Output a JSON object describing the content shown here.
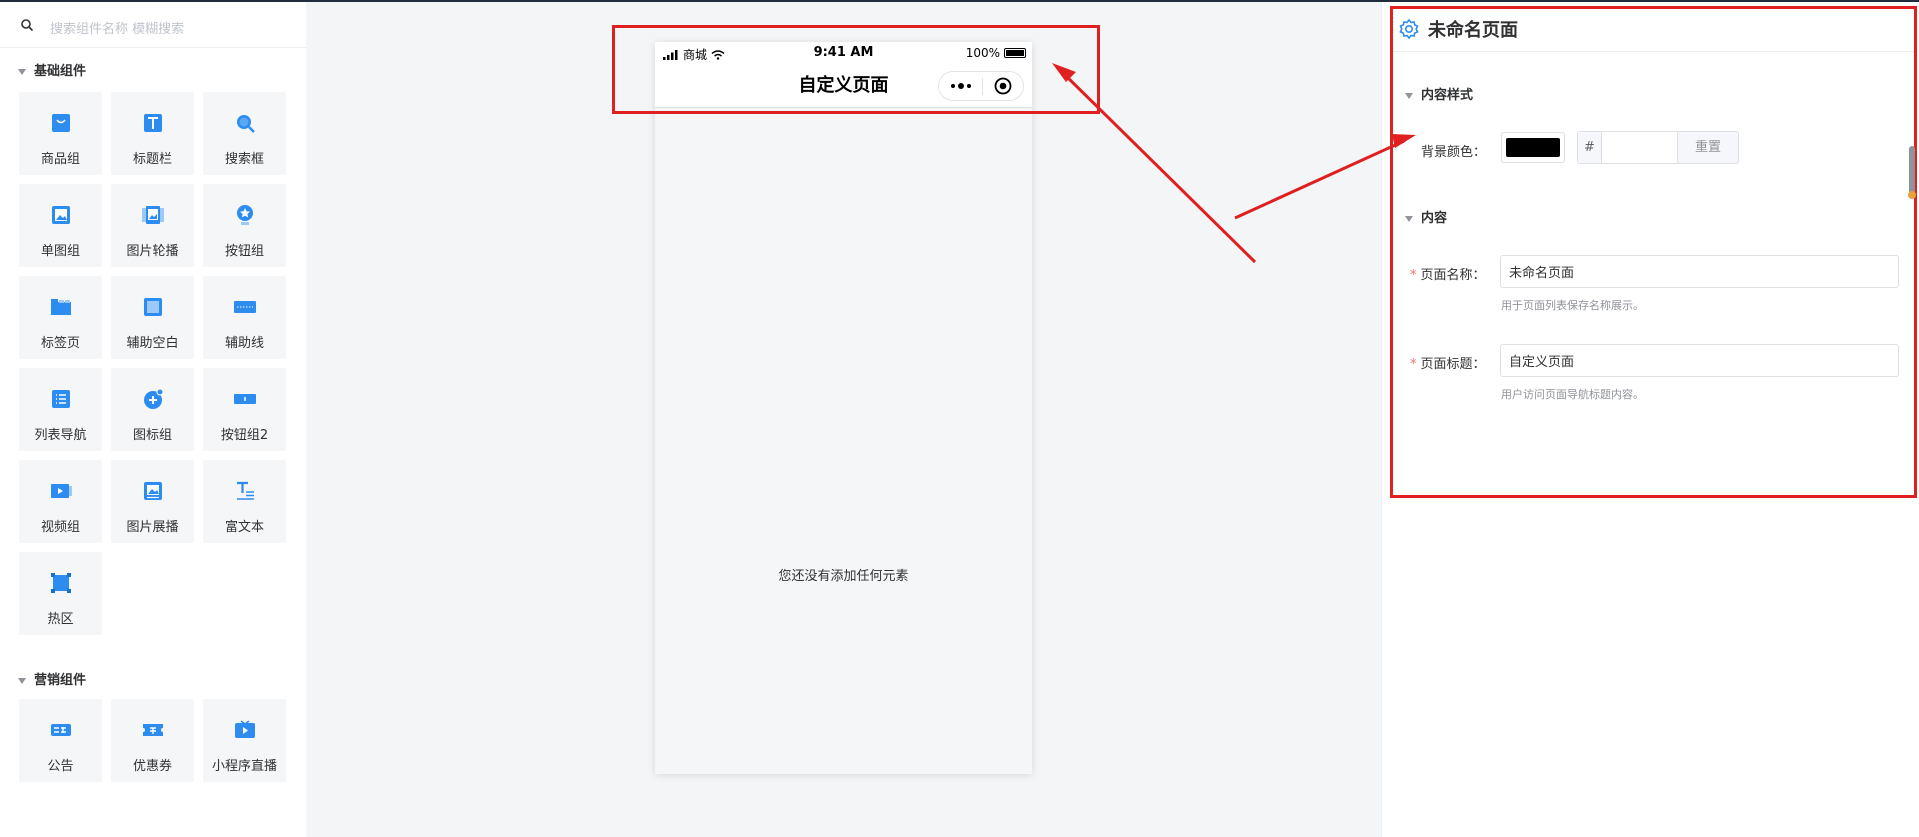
{
  "search": {
    "placeholder": "搜索组件名称 模糊搜索",
    "icon": "search-icon"
  },
  "categories": [
    {
      "title": "基础组件",
      "items": [
        {
          "label": "商品组",
          "icon": "product-group-icon"
        },
        {
          "label": "标题栏",
          "icon": "title-bar-icon"
        },
        {
          "label": "搜索框",
          "icon": "search-box-icon"
        },
        {
          "label": "单图组",
          "icon": "single-image-icon"
        },
        {
          "label": "图片轮播",
          "icon": "image-carousel-icon"
        },
        {
          "label": "按钮组",
          "icon": "button-group-icon"
        },
        {
          "label": "标签页",
          "icon": "tabs-icon"
        },
        {
          "label": "辅助空白",
          "icon": "blank-space-icon"
        },
        {
          "label": "辅助线",
          "icon": "divider-line-icon"
        },
        {
          "label": "列表导航",
          "icon": "list-nav-icon"
        },
        {
          "label": "图标组",
          "icon": "icon-group-icon"
        },
        {
          "label": "按钮组2",
          "icon": "button-group2-icon"
        },
        {
          "label": "视频组",
          "icon": "video-group-icon"
        },
        {
          "label": "图片展播",
          "icon": "image-showcase-icon"
        },
        {
          "label": "富文本",
          "icon": "rich-text-icon"
        },
        {
          "label": "热区",
          "icon": "hotspot-icon"
        }
      ]
    },
    {
      "title": "营销组件",
      "items": [
        {
          "label": "公告",
          "icon": "notice-icon"
        },
        {
          "label": "优惠券",
          "icon": "coupon-icon"
        },
        {
          "label": "小程序直播",
          "icon": "live-stream-icon"
        }
      ]
    }
  ],
  "phone": {
    "carrier": "商城",
    "time": "9:41 AM",
    "battery": "100%",
    "nav_title": "自定义页面",
    "empty_message": "您还没有添加任何元素"
  },
  "panel": {
    "title": "未命名页面",
    "section_style": "内容样式",
    "bg_color_label": "背景颜色：",
    "hex_prefix": "#",
    "reset_label": "重置",
    "section_content": "内容",
    "page_name_label": "页面名称：",
    "page_name_value": "未命名页面",
    "page_name_help": "用于页面列表保存名称展示。",
    "page_title_label": "页面标题：",
    "page_title_value": "自定义页面",
    "page_title_help": "用户访问页面导航标题内容。"
  },
  "colors": {
    "accent": "#2d8cf0",
    "highlight": "#e02020",
    "bg_color": "#000000"
  }
}
